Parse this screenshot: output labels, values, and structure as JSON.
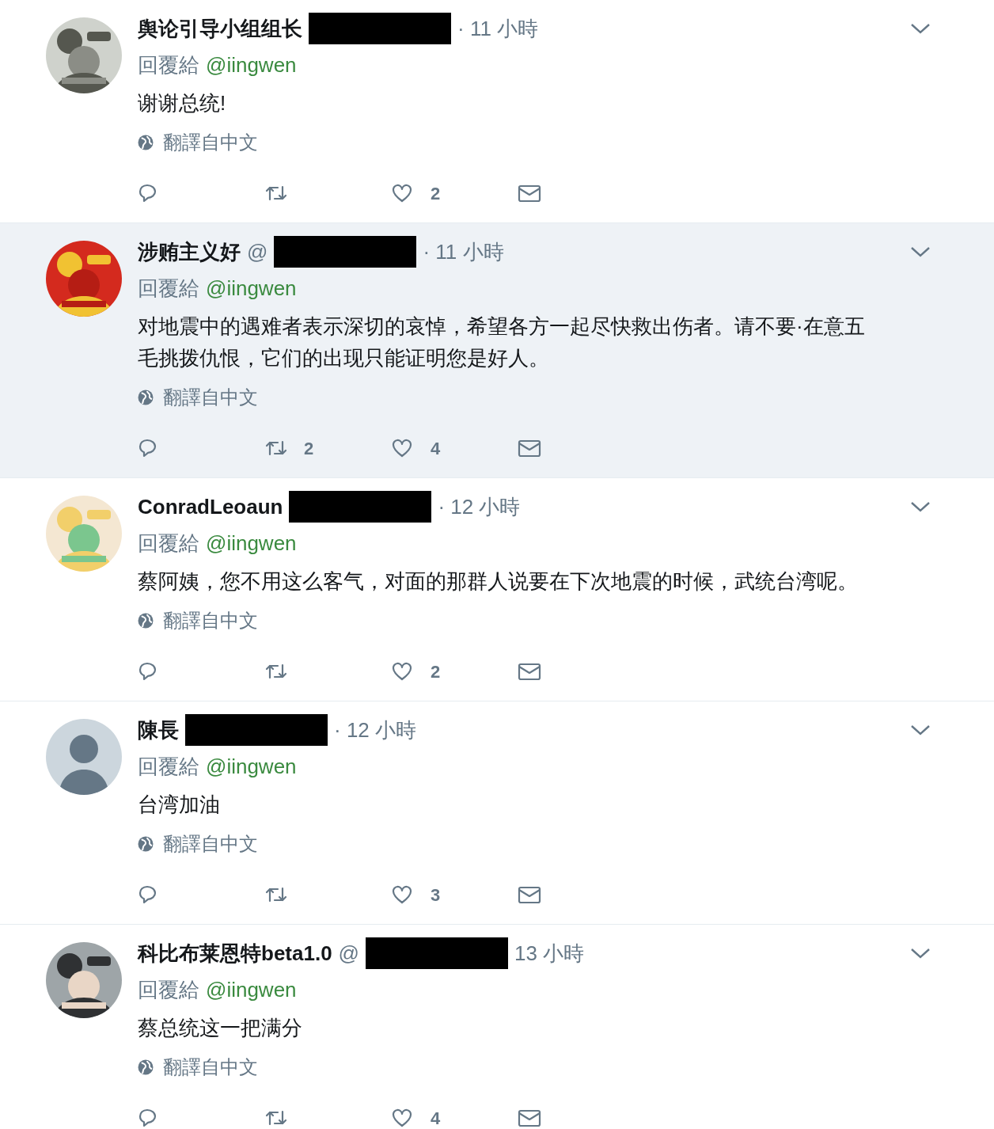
{
  "tweets": [
    {
      "name": "舆论引导小组组长",
      "time": "· 11 小時",
      "highlighted": false,
      "avatar": {
        "kind": "picture"
      },
      "reply_label": "回覆給",
      "reply_to": "@iingwen",
      "text": [
        "谢谢总统!"
      ],
      "translate": "翻譯自中文",
      "likes": "2"
    },
    {
      "name": "涉贿主义好",
      "handle": "@",
      "time": "· 11 小時",
      "highlighted": true,
      "avatar": {
        "kind": "picture"
      },
      "reply_label": "回覆給",
      "reply_to": "@iingwen",
      "text": [
        "对地震中的遇难者表示深切的哀悼，希望各方一起尽快救出伤者。请不要·在意五",
        "毛挑拨仇恨，它们的出现只能证明您是好人。"
      ],
      "translate": "翻譯自中文",
      "retweets": "2",
      "likes": "4"
    },
    {
      "name": "ConradLeoaun",
      "time": "· 12 小時",
      "highlighted": false,
      "avatar": {
        "kind": "picture"
      },
      "reply_label": "回覆給",
      "reply_to": "@iingwen",
      "text": [
        "蔡阿姨，您不用这么客气，对面的那群人说要在下次地震的时候，武统台湾呢。"
      ],
      "translate": "翻譯自中文",
      "likes": "2"
    },
    {
      "name": "陳長",
      "time": "· 12 小時",
      "highlighted": false,
      "avatar": {
        "kind": "default"
      },
      "reply_label": "回覆給",
      "reply_to": "@iingwen",
      "text": [
        "台湾加油"
      ],
      "translate": "翻譯自中文",
      "likes": "3"
    },
    {
      "name": "科比布莱恩特beta1.0",
      "handle": "@",
      "time": "13 小時",
      "highlighted": false,
      "avatar": {
        "kind": "picture"
      },
      "reply_label": "回覆給",
      "reply_to": "@iingwen",
      "text": [
        "蔡总统这一把满分"
      ],
      "translate": "翻譯自中文",
      "likes": "4"
    }
  ]
}
